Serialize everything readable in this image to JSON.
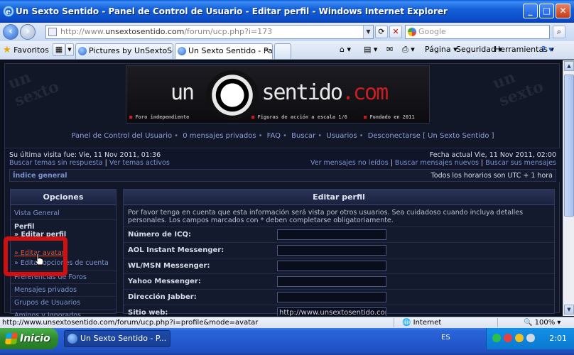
{
  "window": {
    "title": "Un Sexto Sentido - Panel de Control de Usuario - Editar perfil - Windows Internet Explorer"
  },
  "address_bar": {
    "url_prefix": "http://www.",
    "url_domain": "unsextosentido.com",
    "url_path": "/forum/ucp.php?i=173",
    "search_placeholder": "Google"
  },
  "favorites_bar": {
    "favorites_label": "Favoritos",
    "tabs": [
      {
        "label": "Pictures by UnSextoSentido -...",
        "active": false
      },
      {
        "label": "Un Sexto Sentido - Panel ...",
        "active": true
      }
    ],
    "commands": [
      "Página",
      "Seguridad",
      "Herramientas"
    ]
  },
  "banner": {
    "brand_left": "un",
    "brand_right": "sentido",
    "brand_suffix": ".com",
    "emblem_text": "un sexto sentido",
    "tag_left": "Foro independiente",
    "tag_mid": "Figuras de acción a escala 1/6",
    "tag_right": "Fundado en 2011"
  },
  "nav": {
    "items": [
      "Panel de Control del Usuario",
      "0 mensajes privados",
      "FAQ",
      "Buscar",
      "Usuarios",
      "Desconectarse [ Un Sexto Sentido ]"
    ]
  },
  "info": {
    "last_visit": "Su última visita fue: Vie, 11 Nov 2011, 01:36",
    "search_unanswered": "Buscar temas sin respuesta",
    "view_active": "Ver temas activos",
    "current_date": "Fecha actual Vie, 11 Nov 2011, 02:00",
    "unread": "Ver mensajes no leídos",
    "new_posts": "Buscar mensajes nuevos",
    "your_posts": "Buscar sus mensajes",
    "index_link": "Índice general",
    "timezone": "Todos los horarios son UTC + 1 hora"
  },
  "options_panel": {
    "header": "Opciones",
    "overview": "Vista General",
    "profile_section": "Perfil",
    "items": [
      {
        "label": "» Editar perfil"
      },
      {
        "label": "» Editar avatar"
      },
      {
        "label": "» Editar opciones de cuenta"
      }
    ],
    "partial_item": "Preferencias de Foros",
    "private_messages": "Mensajes privados",
    "user_groups": "Grupos de Usuarios",
    "friends": "Amigos y Ignorados"
  },
  "edit_profile": {
    "header": "Editar perfil",
    "notice": "Por favor tenga en cuenta que esta información será vista por otros usuarios. Sea cuidadoso cuando incluya detalles personales. Los campos marcados con * deben completarse obligatoriamente.",
    "fields": [
      {
        "label": "Número de ICQ:",
        "value": ""
      },
      {
        "label": "AOL Instant Messenger:",
        "value": ""
      },
      {
        "label": "WL/MSN Messenger:",
        "value": ""
      },
      {
        "label": "Yahoo Messenger:",
        "value": ""
      },
      {
        "label": "Dirección Jabber:",
        "value": ""
      },
      {
        "label": "Sitio web:",
        "value": "http://www.unsextosentido.com/"
      }
    ]
  },
  "status_bar": {
    "url": "http://www.unsextosentido.com/forum/ucp.php?i=profile&mode=avatar",
    "zone": "Internet",
    "zoom": "100%"
  },
  "taskbar": {
    "start_label": "Inicio",
    "task_label": "Un Sexto Sentido - P...",
    "language": "ES",
    "clock": "2:01"
  },
  "colors": {
    "highlight": "#d01010",
    "link": "#7a92d0",
    "accent_red": "#c82020"
  }
}
